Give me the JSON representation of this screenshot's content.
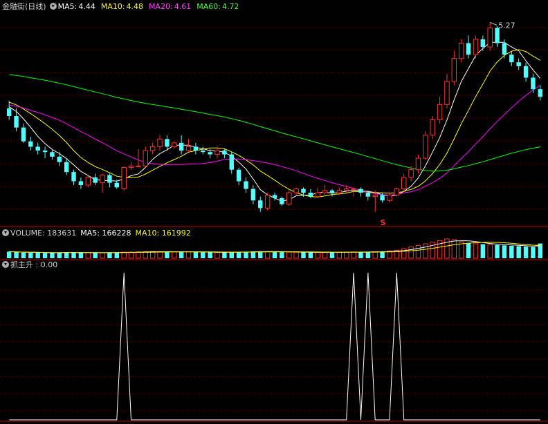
{
  "header": {
    "stock": "金融街(日线)",
    "ma5_label": "MA5:",
    "ma5_value": "4.44",
    "ma10_label": "MA10:",
    "ma10_value": "4.48",
    "ma20_label": "MA20:",
    "ma20_value": "4.61",
    "ma60_label": "MA60:",
    "ma60_value": "4.72"
  },
  "volume_header": {
    "label": "VOLUME: 183631",
    "ma5": "MA5: 166228",
    "ma10": "MA10: 161992"
  },
  "indicator_header": {
    "label": "抓主升 : 0.00"
  },
  "annotations": {
    "high_label": "5.27",
    "marker": "S"
  },
  "colors": {
    "up": "#ff3232",
    "down": "#54fcfc",
    "ma5": "#ffffff",
    "ma10": "#ffff00",
    "ma20": "#ff00ff",
    "ma60": "#00ff00",
    "grid": "#7a0000"
  },
  "chart_data": [
    {
      "type": "candlestick",
      "price_range": [
        3.4,
        5.5
      ],
      "highest": 5.27,
      "candles": [
        [
          4.15,
          4.05,
          4.25,
          4.0
        ],
        [
          4.05,
          3.9,
          4.15,
          3.85
        ],
        [
          3.9,
          3.72,
          3.95,
          3.7
        ],
        [
          3.72,
          3.65,
          3.78,
          3.6
        ],
        [
          3.65,
          3.6,
          3.7,
          3.55
        ],
        [
          3.6,
          3.58,
          3.65,
          3.5
        ],
        [
          3.58,
          3.52,
          3.62,
          3.48
        ],
        [
          3.52,
          3.45,
          3.58,
          3.4
        ],
        [
          3.45,
          3.32,
          3.5,
          3.28
        ],
        [
          3.32,
          3.2,
          3.35,
          3.15
        ],
        [
          3.2,
          3.15,
          3.25,
          3.1
        ],
        [
          3.15,
          3.25,
          3.28,
          3.12
        ],
        [
          3.25,
          3.18,
          3.3,
          3.15
        ],
        [
          3.18,
          3.28,
          3.3,
          3.05
        ],
        [
          3.28,
          3.18,
          3.3,
          3.12
        ],
        [
          3.18,
          3.12,
          3.22,
          3.1
        ],
        [
          3.1,
          3.38,
          3.4,
          3.08
        ],
        [
          3.38,
          3.4,
          3.45,
          3.35
        ],
        [
          3.4,
          3.4,
          3.62,
          3.38
        ],
        [
          3.4,
          3.6,
          3.65,
          3.38
        ],
        [
          3.6,
          3.65,
          3.7,
          3.55
        ],
        [
          3.65,
          3.75,
          3.8,
          3.6
        ],
        [
          3.75,
          3.65,
          3.8,
          3.6
        ],
        [
          3.65,
          3.7,
          3.72,
          3.62
        ],
        [
          3.7,
          3.6,
          3.8,
          3.55
        ],
        [
          3.6,
          3.65,
          3.75,
          3.58
        ],
        [
          3.65,
          3.6,
          3.7,
          3.55
        ],
        [
          3.6,
          3.58,
          3.65,
          3.55
        ],
        [
          3.58,
          3.55,
          3.62,
          3.5
        ],
        [
          3.55,
          3.6,
          3.65,
          3.5
        ],
        [
          3.6,
          3.55,
          3.62,
          3.5
        ],
        [
          3.55,
          3.35,
          3.58,
          3.3
        ],
        [
          3.35,
          3.2,
          3.38,
          3.15
        ],
        [
          3.2,
          3.1,
          3.25,
          3.05
        ],
        [
          3.1,
          2.95,
          3.15,
          2.9
        ],
        [
          2.95,
          2.85,
          3.0,
          2.8
        ],
        [
          2.85,
          3.02,
          3.05,
          2.82
        ],
        [
          3.02,
          2.98,
          3.05,
          2.95
        ],
        [
          2.98,
          2.9,
          3.0,
          2.88
        ],
        [
          2.9,
          3.05,
          3.08,
          2.88
        ],
        [
          3.05,
          3.1,
          3.12,
          3.02
        ],
        [
          3.1,
          3.05,
          3.12,
          3.0
        ],
        [
          3.05,
          3.0,
          3.1,
          2.98
        ],
        [
          3.0,
          3.05,
          3.12,
          2.98
        ],
        [
          3.05,
          3.08,
          3.15,
          3.02
        ],
        [
          3.08,
          3.05,
          3.1,
          3.0
        ],
        [
          3.05,
          3.08,
          3.12,
          3.02
        ],
        [
          3.08,
          3.1,
          3.15,
          3.05
        ],
        [
          3.1,
          3.1,
          3.12,
          3.0
        ],
        [
          3.1,
          3.05,
          3.12,
          3.0
        ],
        [
          3.05,
          3.0,
          3.08,
          2.95
        ],
        [
          3.0,
          3.02,
          3.08,
          2.8
        ],
        [
          3.02,
          2.95,
          3.05,
          2.92
        ],
        [
          2.95,
          3.02,
          3.05,
          2.92
        ],
        [
          3.02,
          3.1,
          3.12,
          3.0
        ],
        [
          3.1,
          3.25,
          3.3,
          3.08
        ],
        [
          3.25,
          3.35,
          3.4,
          3.2
        ],
        [
          3.35,
          3.5,
          3.55,
          3.3
        ],
        [
          3.5,
          3.8,
          3.85,
          3.48
        ],
        [
          3.8,
          4.0,
          4.05,
          3.75
        ],
        [
          4.0,
          4.2,
          4.3,
          3.95
        ],
        [
          4.2,
          4.5,
          4.6,
          4.15
        ],
        [
          4.5,
          4.8,
          4.9,
          4.45
        ],
        [
          4.8,
          5.0,
          5.05,
          4.75
        ],
        [
          5.0,
          4.85,
          5.1,
          4.8
        ],
        [
          4.85,
          5.05,
          5.1,
          4.8
        ],
        [
          5.05,
          4.95,
          5.1,
          4.9
        ],
        [
          4.95,
          5.2,
          5.27,
          4.9
        ],
        [
          5.2,
          5.0,
          5.22,
          4.95
        ],
        [
          5.0,
          4.85,
          5.05,
          4.8
        ],
        [
          4.85,
          4.75,
          4.9,
          4.7
        ],
        [
          4.75,
          4.7,
          4.8,
          4.65
        ],
        [
          4.7,
          4.55,
          4.75,
          4.5
        ],
        [
          4.55,
          4.4,
          4.6,
          4.35
        ],
        [
          4.4,
          4.3,
          4.45,
          4.25
        ]
      ],
      "ma_lines": {
        "ma5": [],
        "ma10": [],
        "ma20": [],
        "ma60": []
      }
    },
    {
      "type": "bar",
      "name": "VOLUME",
      "values": [
        82000,
        76000,
        71000,
        68000,
        70000,
        65000,
        68000,
        72000,
        75000,
        70000,
        68000,
        70000,
        72000,
        68000,
        71000,
        73000,
        76000,
        78000,
        80000,
        82000,
        85000,
        83000,
        80000,
        79000,
        81000,
        78000,
        76000,
        74000,
        73000,
        72000,
        75000,
        78000,
        80000,
        82000,
        85000,
        86000,
        82000,
        80000,
        78000,
        76000,
        75000,
        74000,
        73000,
        72000,
        74000,
        75000,
        76000,
        77000,
        78000,
        79000,
        80000,
        82000,
        85000,
        90000,
        100000,
        120000,
        140000,
        160000,
        180000,
        200000,
        220000,
        240000,
        230000,
        200000,
        190000,
        180000,
        175000,
        170000,
        165000,
        160000,
        155000,
        150000,
        145000,
        140000,
        183631
      ]
    },
    {
      "type": "line",
      "name": "抓主升",
      "values": [
        0,
        0,
        0,
        0,
        0,
        0,
        0,
        0,
        0,
        0,
        0,
        0,
        0,
        0,
        0,
        0,
        1,
        0,
        0,
        0,
        0,
        0,
        0,
        0,
        0,
        0,
        0,
        0,
        0,
        0,
        0,
        0,
        0,
        0,
        0,
        0,
        0,
        0,
        0,
        0,
        0,
        0,
        0,
        0,
        0,
        0,
        0,
        0,
        1,
        0,
        1,
        0,
        0,
        0,
        1,
        0,
        0,
        0,
        0,
        0,
        0,
        0,
        0,
        0,
        0,
        0,
        0,
        0,
        0,
        0,
        0,
        0,
        0,
        0,
        0
      ],
      "ylim": [
        0,
        1
      ]
    }
  ]
}
